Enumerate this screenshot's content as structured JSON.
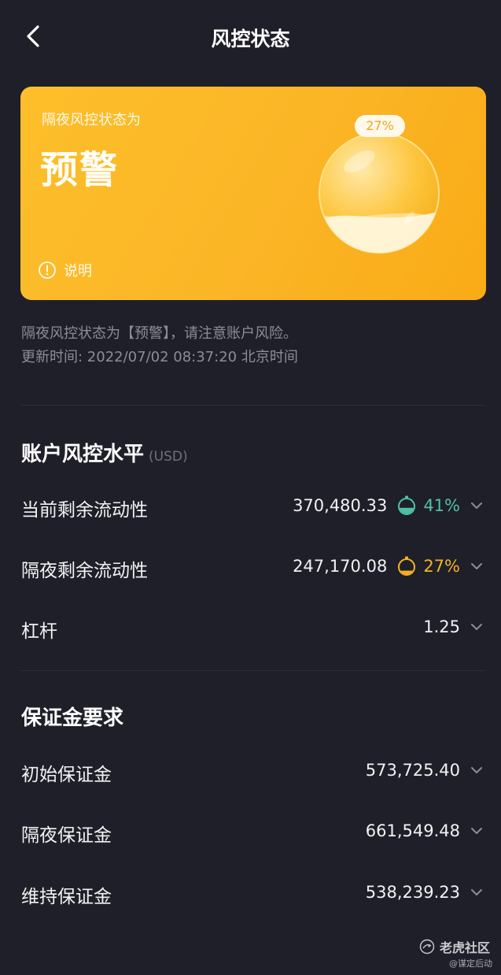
{
  "header": {
    "title": "风控状态"
  },
  "card": {
    "subtitle": "隔夜风控状态为",
    "status": "预警",
    "percent": "27%",
    "fill_fraction": 0.27,
    "explain_label": "说明",
    "colors": {
      "card": "#fbb526",
      "accent": "#f3a517"
    }
  },
  "notice": {
    "line1": "隔夜风控状态为【预警】，请注意账户风险。",
    "line2": "更新时间: 2022/07/02 08:37:20 北京时间"
  },
  "risk_section": {
    "title": "账户风控水平",
    "unit": "(USD)",
    "rows": [
      {
        "label": "当前剩余流动性",
        "value": "370,480.33",
        "percent": "41%",
        "percent_color": "#4fc1a3",
        "gauge_fill": 0.41
      },
      {
        "label": "隔夜剩余流动性",
        "value": "247,170.08",
        "percent": "27%",
        "percent_color": "#f5b325",
        "gauge_fill": 0.27
      },
      {
        "label": "杠杆",
        "value": "1.25"
      }
    ]
  },
  "margin_section": {
    "title": "保证金要求",
    "rows": [
      {
        "label": "初始保证金",
        "value": "573,725.40"
      },
      {
        "label": "隔夜保证金",
        "value": "661,549.48"
      },
      {
        "label": "维持保证金",
        "value": "538,239.23"
      }
    ]
  },
  "watermark": {
    "brand": "老虎社区",
    "user": "@谋定后动"
  }
}
